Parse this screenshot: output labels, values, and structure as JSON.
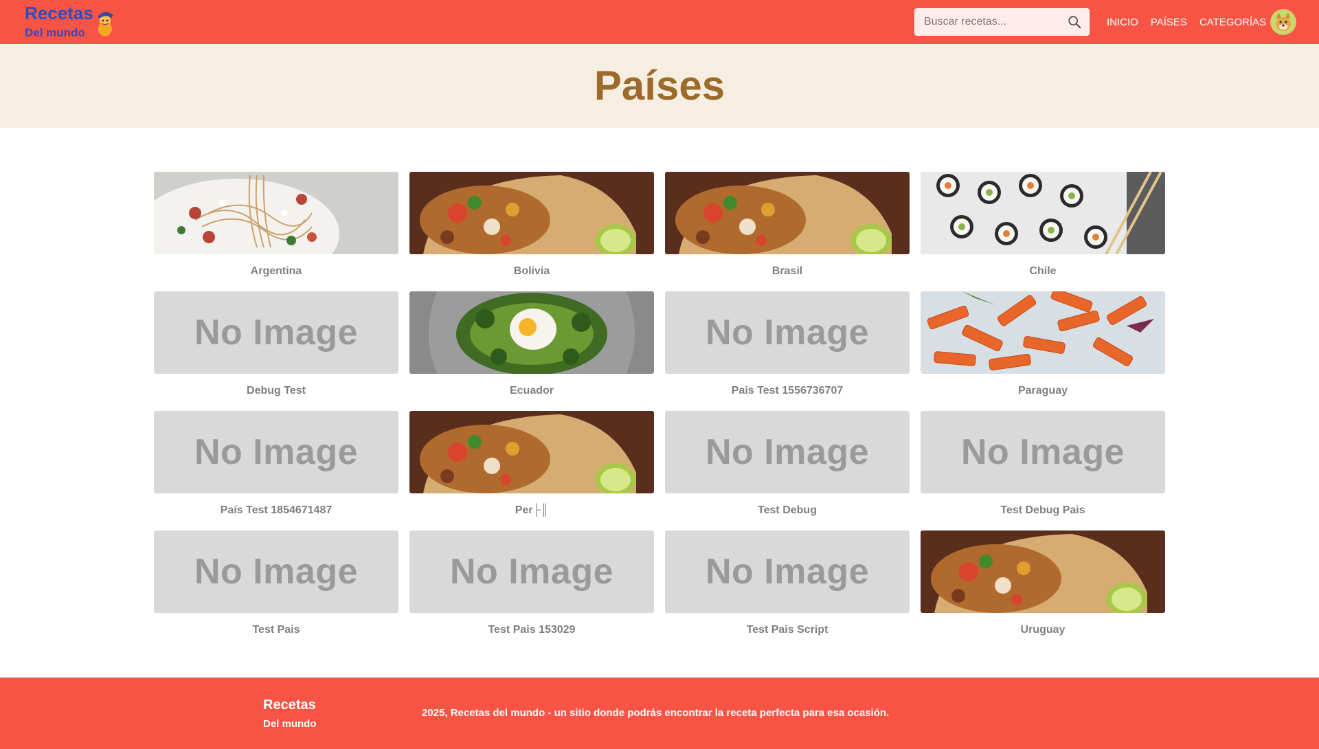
{
  "brand": {
    "line1": "Recetas",
    "line2": "Del mundo",
    "color": "#2f4dbf"
  },
  "search": {
    "placeholder": "Buscar recetas..."
  },
  "nav": {
    "items": [
      "INICIO",
      "PAÍSES",
      "CATEGORÍAS"
    ]
  },
  "theme": {
    "primary": "#f75445",
    "hero_bg": "#f6efe1",
    "title_color": "#9c6b2c"
  },
  "page": {
    "title": "Países"
  },
  "countries": [
    {
      "name": "Argentina",
      "image": "pasta"
    },
    {
      "name": "Bolivia",
      "image": "burrito"
    },
    {
      "name": "Brasil",
      "image": "burrito"
    },
    {
      "name": "Chile",
      "image": "sushi"
    },
    {
      "name": "Debug Test",
      "image": "no-image"
    },
    {
      "name": "Ecuador",
      "image": "egg-avocado"
    },
    {
      "name": "Pais Test 1556736707",
      "image": "no-image"
    },
    {
      "name": "Paraguay",
      "image": "penne"
    },
    {
      "name": "País Test 1854671487",
      "image": "no-image"
    },
    {
      "name": "Per├║",
      "image": "burrito"
    },
    {
      "name": "Test Debug",
      "image": "no-image"
    },
    {
      "name": "Test Debug Pais",
      "image": "no-image"
    },
    {
      "name": "Test Pais",
      "image": "no-image"
    },
    {
      "name": "Test Pais 153029",
      "image": "no-image"
    },
    {
      "name": "Test Pais Script",
      "image": "no-image"
    },
    {
      "name": "Uruguay",
      "image": "burrito"
    }
  ],
  "no_image_text": "No Image",
  "footer": {
    "line1": "Recetas",
    "line2": "Del mundo",
    "copyright": "2025, Recetas del mundo - un sitio donde podrás encontrar la receta perfecta para esa ocasión."
  }
}
